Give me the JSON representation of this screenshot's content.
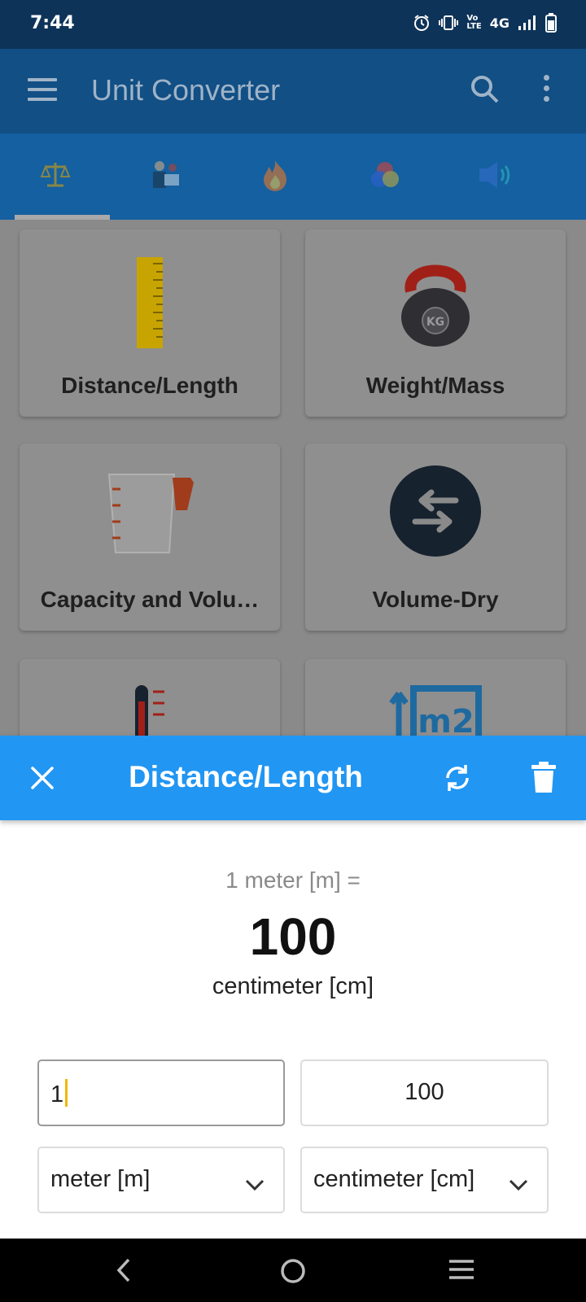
{
  "status": {
    "time": "7:44",
    "network": "4G"
  },
  "app": {
    "title": "Unit Converter"
  },
  "tabs": [
    {
      "icon": "balance-scale-icon"
    },
    {
      "icon": "engineering-icon"
    },
    {
      "icon": "fire-icon"
    },
    {
      "icon": "color-wheel-icon"
    },
    {
      "icon": "sound-icon"
    }
  ],
  "categories": [
    {
      "label": "Distance/Length",
      "icon": "ruler-icon"
    },
    {
      "label": "Weight/Mass",
      "icon": "kettlebell-icon"
    },
    {
      "label": "Capacity and Volu…",
      "icon": "measuring-jug-icon"
    },
    {
      "label": "Volume-Dry",
      "icon": "swap-arrows-icon"
    },
    {
      "label": "",
      "icon": "thermometer-icon"
    },
    {
      "label": "",
      "icon": "area-m2-icon"
    }
  ],
  "sheet": {
    "title": "Distance/Length",
    "result_prefix": "1 meter [m] =",
    "result_value": "100",
    "result_unit": "centimeter [cm]",
    "input_value": "1",
    "output_value": "100",
    "from_unit": "meter [m]",
    "to_unit": "centimeter [cm]"
  },
  "colors": {
    "accent": "#2196f3",
    "statusbar": "#0e3358"
  }
}
